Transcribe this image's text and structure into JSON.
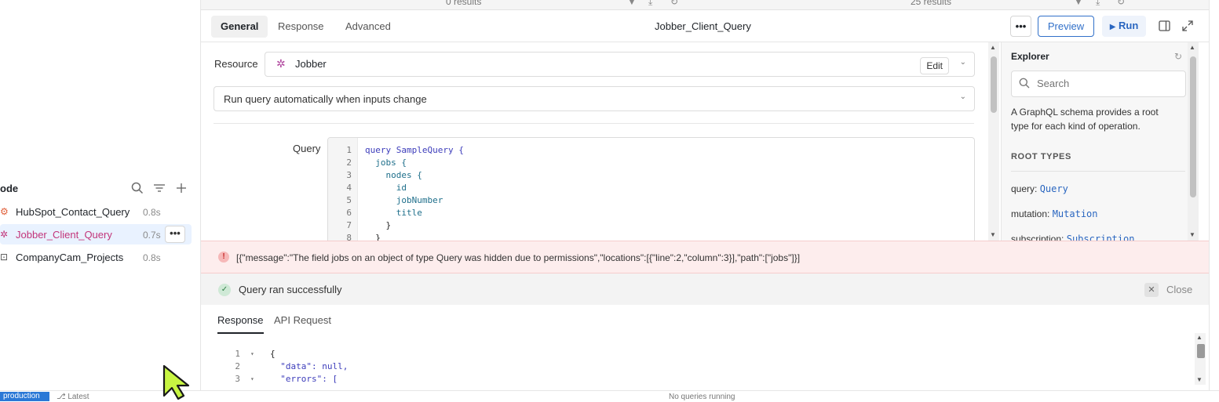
{
  "left_panel": {
    "title": "ode",
    "queries": [
      {
        "name": "HubSpot_Contact_Query",
        "time": "0.8s",
        "icon": "hubspot-icon",
        "color": "#e0603b"
      },
      {
        "name": "Jobber_Client_Query",
        "time": "0.7s",
        "icon": "jobber-icon",
        "color": "#c2357a",
        "selected": true,
        "more": "•••"
      },
      {
        "name": "CompanyCam_Projects",
        "time": "0.8s",
        "icon": "companycam-icon",
        "color": "#555555"
      }
    ]
  },
  "top_strip": {
    "left_results": "0 results",
    "right_results": "25 results"
  },
  "tabs": [
    "General",
    "Response",
    "Advanced"
  ],
  "query_title": "Jobber_Client_Query",
  "toolbar": {
    "more": "•••",
    "preview": "Preview",
    "run": "Run"
  },
  "form": {
    "resource_label": "Resource",
    "resource_value": "Jobber",
    "edit": "Edit",
    "run_mode": "Run query automatically when inputs change",
    "query_label": "Query"
  },
  "code": {
    "lines": [
      "1",
      "2",
      "3",
      "4",
      "5",
      "6",
      "7",
      "8"
    ],
    "content": [
      "query SampleQuery {",
      "  jobs {",
      "    nodes {",
      "      id",
      "      jobNumber",
      "      title",
      "    }",
      "  }"
    ]
  },
  "explorer": {
    "title": "Explorer",
    "search_placeholder": "Search",
    "description": "A GraphQL schema provides a root type for each kind of operation.",
    "root_types_heading": "ROOT TYPES",
    "roots": [
      {
        "label": "query:",
        "type": "Query"
      },
      {
        "label": "mutation:",
        "type": "Mutation"
      },
      {
        "label": "subscription:",
        "type": "Subscription"
      }
    ]
  },
  "error": {
    "icon": "!",
    "message": "[{\"message\":\"The field jobs on an object of type Query was hidden due to permissions\",\"locations\":[{\"line\":2,\"column\":3}],\"path\":[\"jobs\"]}]"
  },
  "success": {
    "message": "Query ran successfully",
    "close": "Close"
  },
  "response": {
    "tabs": [
      "Response",
      "API Request"
    ],
    "lines": [
      "1",
      "2",
      "3"
    ],
    "content": [
      "{",
      "  \"data\": null,",
      "  \"errors\": ["
    ]
  },
  "status_bar": {
    "env": "production",
    "branch": "Latest",
    "running": "No queries running"
  },
  "colors": {
    "accent": "#3170c9",
    "error_bg": "#fdeded",
    "selected_bg": "#e9f2ff"
  }
}
